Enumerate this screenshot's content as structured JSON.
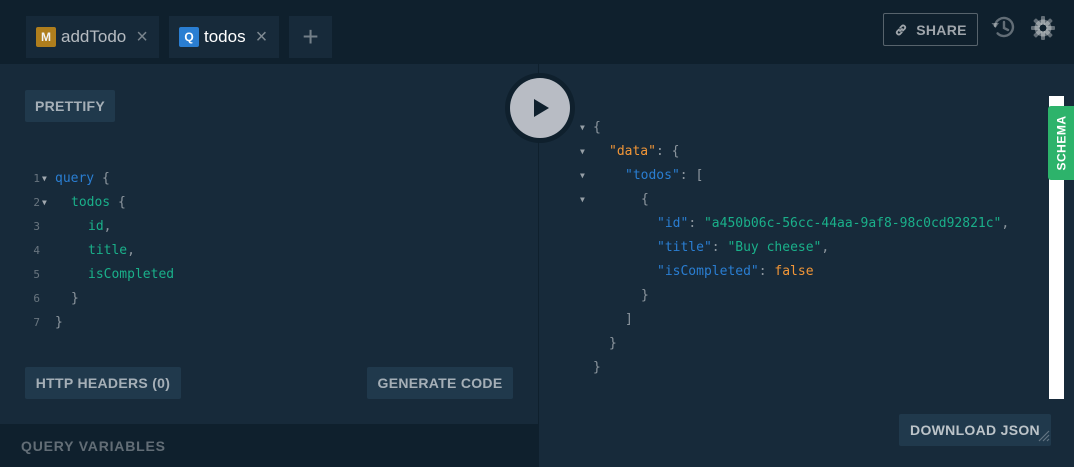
{
  "tabs": [
    {
      "badge": "M",
      "label": "addTodo",
      "close": "×"
    },
    {
      "badge": "Q",
      "label": "todos",
      "close": "×"
    }
  ],
  "add_tab": "+",
  "header": {
    "share_label": "SHARE"
  },
  "icons": {
    "share": "link-icon",
    "history": "history-icon",
    "settings": "gear-icon",
    "execute": "play-icon"
  },
  "editor": {
    "prettify_label": "PRETTIFY",
    "line_numbers": [
      "1",
      "2",
      "3",
      "4",
      "5",
      "6",
      "7"
    ],
    "lines": {
      "l1_kw": "query",
      "l1_brace": " {",
      "l2_field": "todos",
      "l2_brace": " {",
      "l3_field": "id",
      "l3_comma": ",",
      "l4_field": "title",
      "l4_comma": ",",
      "l5_field": "isCompleted",
      "l6_brace": "}",
      "l7_brace": "}"
    },
    "http_headers_label": "HTTP HEADERS (0)",
    "generate_code_label": "GENERATE CODE",
    "query_variables_label": "QUERY VARIABLES"
  },
  "result": {
    "open_brace": "{",
    "data_key": "\"data\"",
    "todos_key": "\"todos\"",
    "id_key": "\"id\"",
    "id_value": "\"a450b06c-56cc-44aa-9af8-98c0cd92821c\"",
    "title_key": "\"title\"",
    "title_value": "\"Buy cheese\"",
    "iscompleted_key": "\"isCompleted\"",
    "iscompleted_value": "false",
    "colon": ": ",
    "comma": ",",
    "obj_open": "{",
    "obj_close": "}",
    "arr_open": "[",
    "arr_close": "]",
    "close_brace": "}"
  },
  "schema_label": "SCHEMA",
  "download_label": "DOWNLOAD JSON",
  "colors": {
    "accent_green": "#2db36b",
    "keyword_blue": "#2a7ed2",
    "field_teal": "#1ab08a",
    "orange": "#f29637"
  }
}
